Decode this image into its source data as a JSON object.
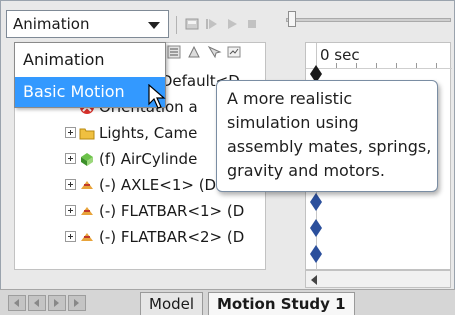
{
  "toolbar": {
    "study_type_value": "Animation"
  },
  "dropdown": {
    "options": [
      "Animation",
      "Basic Motion"
    ],
    "highlighted": "Basic Motion"
  },
  "tooltip": {
    "lines": [
      "A more realistic",
      "simulation using",
      "assembly mates, springs,",
      "gravity and motors."
    ]
  },
  "tree": {
    "rows": [
      {
        "text": "(Default<D"
      },
      {
        "text": "Orientation a"
      },
      {
        "text": "Lights, Came"
      },
      {
        "text": "(f) AirCylinde"
      },
      {
        "text": "(-) AXLE<1> (Defa"
      },
      {
        "text": "(-) FLATBAR<1> (D"
      },
      {
        "text": "(-) FLATBAR<2> (D"
      }
    ]
  },
  "timeline": {
    "ruler_label": "0 sec"
  },
  "tabs": {
    "model": "Model",
    "motion_study": "Motion Study 1"
  },
  "colors": {
    "highlight": "#3399ff",
    "key_blue": "#2b4f9c"
  }
}
